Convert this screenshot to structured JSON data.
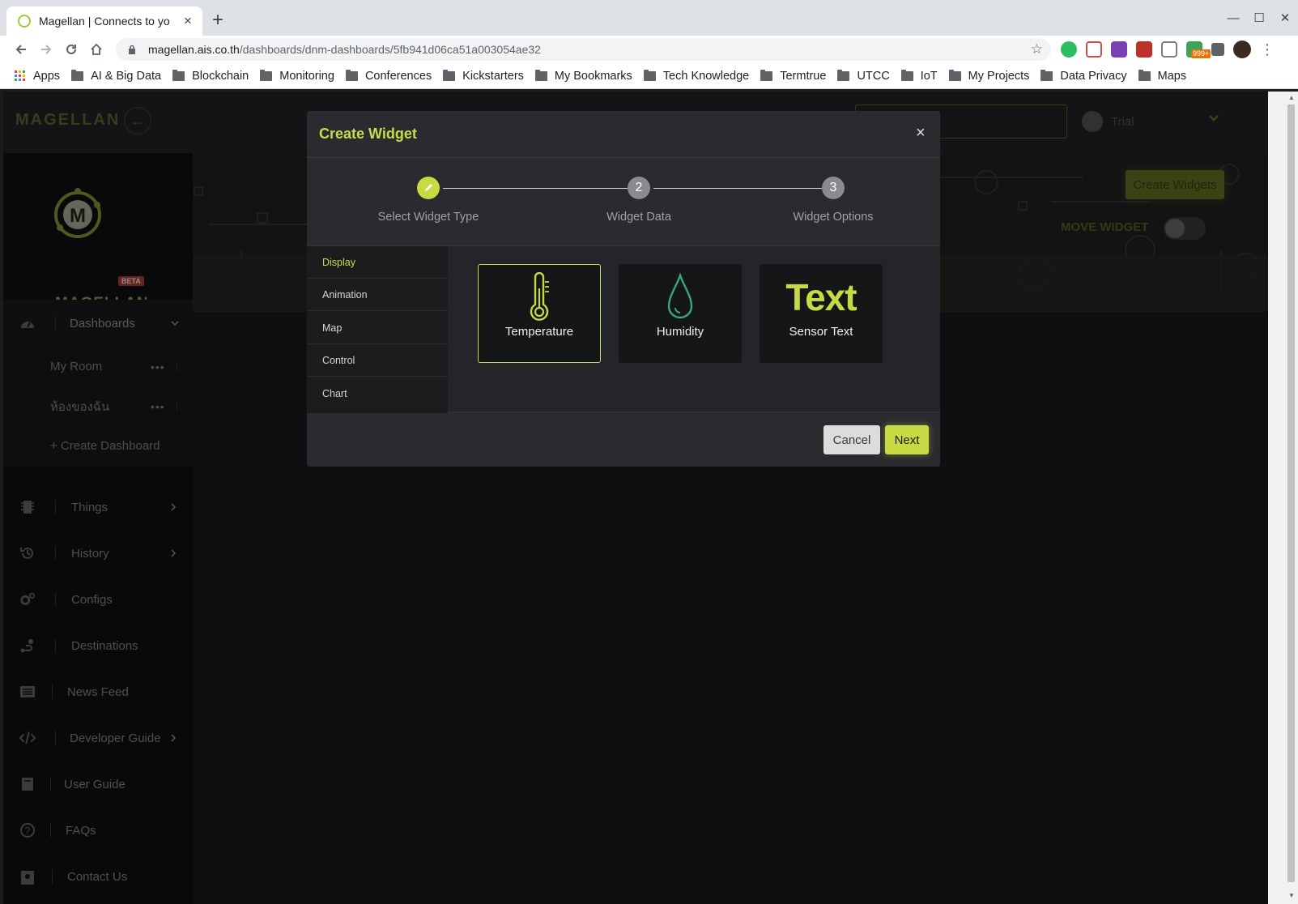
{
  "browser": {
    "tab_title": "Magellan | Connects to yo",
    "url_host": "magellan.ais.co.th",
    "url_path": "/dashboards/dnm-dashboards/5fb941d06ca51a003054ae32",
    "extension_badge": "999+",
    "bookmarks": [
      "Apps",
      "AI & Big Data",
      "Blockchain",
      "Monitoring",
      "Conferences",
      "Kickstarters",
      "My Bookmarks",
      "Tech Knowledge",
      "Termtrue",
      "UTCC",
      "IoT",
      "My Projects",
      "Data Privacy",
      "Maps"
    ]
  },
  "app": {
    "brand": "MAGELLAN",
    "logo_word": "MAGELLAN",
    "beta": "BETA",
    "user_name": "Trial",
    "create_widgets_label": "Create Widgets",
    "move_widget_label": "MOVE WIDGET",
    "sidebar": {
      "dashboards": "Dashboards",
      "sub_items": [
        "My Room",
        "ห้องของฉัน"
      ],
      "create_dashboard": "+ Create Dashboard",
      "items": [
        "Things",
        "History",
        "Configs",
        "Destinations",
        "News Feed",
        "Developer Guide",
        "User Guide",
        "FAQs",
        "Contact Us"
      ]
    }
  },
  "modal": {
    "title": "Create Widget",
    "close": "×",
    "steps": [
      {
        "number": "✓",
        "label": "Select Widget Type"
      },
      {
        "number": "2",
        "label": "Widget Data"
      },
      {
        "number": "3",
        "label": "Widget Options"
      }
    ],
    "categories": [
      "Display",
      "Animation",
      "Map",
      "Control",
      "Chart"
    ],
    "active_category": "Display",
    "widgets": [
      {
        "label": "Temperature",
        "icon": "thermometer-icon"
      },
      {
        "label": "Humidity",
        "icon": "droplet-icon"
      },
      {
        "label": "Sensor Text",
        "icon_text": "Text"
      }
    ],
    "selected_widget": "Temperature",
    "cancel_label": "Cancel",
    "next_label": "Next"
  },
  "colors": {
    "accent": "#c7da44",
    "background": "#1b1c1f",
    "modal": "#2a2b2e"
  }
}
